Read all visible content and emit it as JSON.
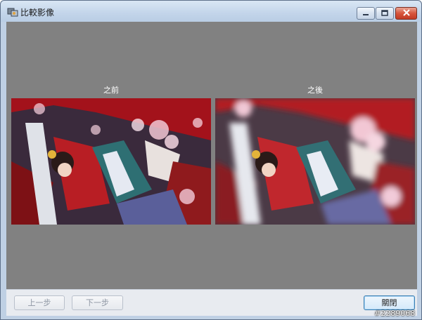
{
  "window": {
    "title": "比較影像",
    "app_icon": "compare-images-app-icon",
    "controls": {
      "minimize_icon": "minimize-icon",
      "maximize_icon": "maximize-icon",
      "close_icon": "close-icon"
    }
  },
  "comparison": {
    "before_label": "之前",
    "after_label": "之後",
    "before_image": "photo-before",
    "after_image": "photo-after-blurred"
  },
  "footer": {
    "prev_label": "上一步",
    "next_label": "下一步",
    "close_label": "關閉"
  },
  "watermark": "#2289068",
  "colors": {
    "client_background": "#818181",
    "close_button": "#c23b24",
    "default_button_border": "#3c7fb1"
  }
}
